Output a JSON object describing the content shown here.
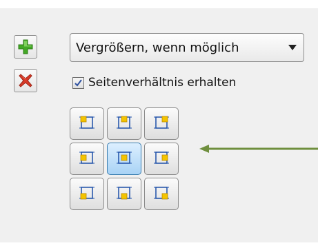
{
  "actions": {
    "add_icon": "plus-icon",
    "delete_icon": "delete-x-icon"
  },
  "scale_mode": {
    "selected": "Vergrößern, wenn möglich"
  },
  "keep_aspect": {
    "label": "Seitenverhältnis erhalten",
    "checked": true
  },
  "anchor_grid": {
    "positions": [
      "top-left",
      "top-center",
      "top-right",
      "middle-left",
      "center",
      "middle-right",
      "bottom-left",
      "bottom-center",
      "bottom-right"
    ],
    "selected": "center"
  },
  "colors": {
    "accent_green": "#43a825",
    "delete_red": "#d83a28",
    "anchor_yellow": "#f4c400",
    "anchor_blue": "#1c4fa8",
    "pointer_green": "#6f8f3e"
  }
}
